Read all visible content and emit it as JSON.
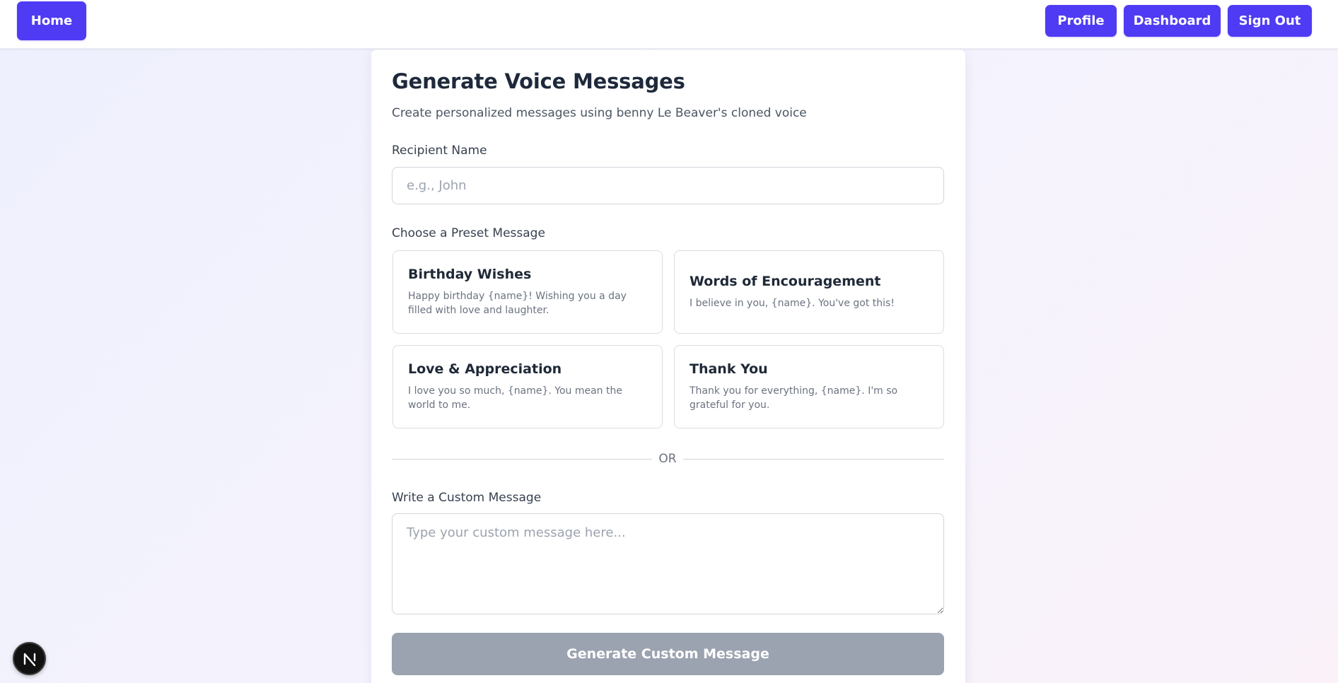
{
  "nav": {
    "home": "Home",
    "profile": "Profile",
    "dashboard": "Dashboard",
    "sign_out": "Sign Out"
  },
  "page": {
    "title": "Generate Voice Messages",
    "subtitle": "Create personalized messages using benny Le Beaver's cloned voice"
  },
  "recipient": {
    "label": "Recipient Name",
    "placeholder": "e.g., John",
    "value": ""
  },
  "presets": {
    "label": "Choose a Preset Message",
    "items": [
      {
        "title": "Birthday Wishes",
        "text": "Happy birthday {name}! Wishing you a day filled with love and laughter."
      },
      {
        "title": "Words of Encouragement",
        "text": "I believe in you, {name}. You've got this!"
      },
      {
        "title": "Love & Appreciation",
        "text": "I love you so much, {name}. You mean the world to me."
      },
      {
        "title": "Thank You",
        "text": "Thank you for everything, {name}. I'm so grateful for you."
      }
    ]
  },
  "divider": {
    "text": "OR"
  },
  "custom": {
    "label": "Write a Custom Message",
    "placeholder": "Type your custom message here...",
    "value": ""
  },
  "generate_button": {
    "label": "Generate Custom Message",
    "disabled": true
  },
  "colors": {
    "accent": "#4f3bf4",
    "disabled_button": "#9ba3b0",
    "title": "#1e293b",
    "muted_text": "#6b7280"
  },
  "icons": {
    "dev_badge": "nextjs-logo-icon"
  }
}
